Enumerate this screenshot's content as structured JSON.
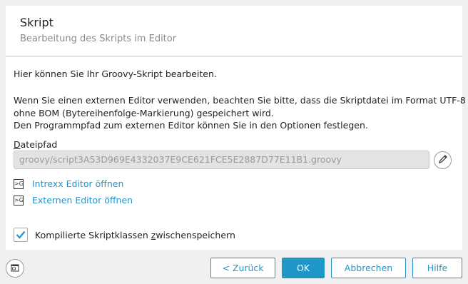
{
  "dialog": {
    "title": "Skript",
    "subtitle": "Bearbeitung des Skripts im Editor"
  },
  "content": {
    "intro": "Hier können Sie Ihr Groovy-Skript bearbeiten.",
    "info_line1": "Wenn Sie einen externen Editor verwenden, beachten Sie bitte, dass die Skriptdatei im Format UTF-8",
    "info_line2": "ohne BOM (Bytereihenfolge-Markierung) gespeichert wird.",
    "info_line3": "Den Programmpfad zum externen Editor können Sie in den Optionen festlegen.",
    "path_label": "Dateipfad",
    "path_value": "groovy/script3A53D969E4332037E9CE621FCE5E2887D77E11B1.groovy",
    "links": [
      {
        "label": "Intrexx Editor öffnen",
        "icon": "groovy-file-icon"
      },
      {
        "label": "Externen Editor öffnen",
        "icon": "groovy-file-icon"
      }
    ],
    "checkbox": {
      "label": "Kompilierte Skriptklassen zwischenspeichern",
      "checked": true
    }
  },
  "footer": {
    "back": "< Zurück",
    "ok": "OK",
    "cancel": "Abbrechen",
    "help": "Hilfe",
    "left_icon": "window-icon"
  },
  "colors": {
    "accent": "#1e96c8",
    "link": "#2496c8",
    "background": "#f0f0f0"
  }
}
